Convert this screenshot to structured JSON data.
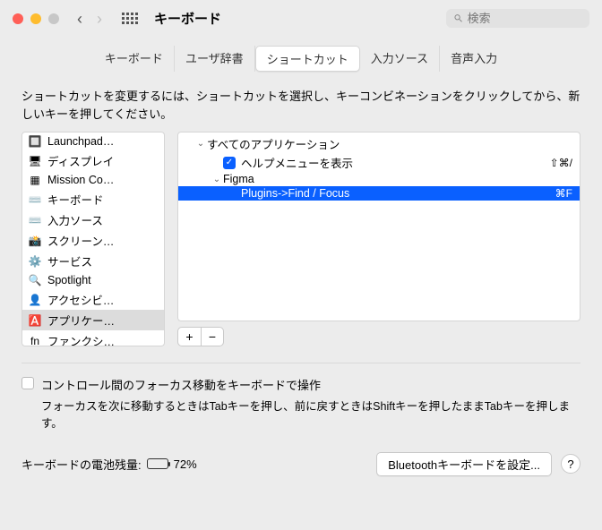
{
  "header": {
    "title": "キーボード",
    "search_placeholder": "検索"
  },
  "tabs": [
    {
      "label": "キーボード",
      "active": false
    },
    {
      "label": "ユーザ辞書",
      "active": false
    },
    {
      "label": "ショートカット",
      "active": true
    },
    {
      "label": "入力ソース",
      "active": false
    },
    {
      "label": "音声入力",
      "active": false
    }
  ],
  "panel": {
    "instruction": "ショートカットを変更するには、ショートカットを選択し、キーコンビネーションをクリックしてから、新しいキーを押してください。"
  },
  "categories": [
    {
      "icon": "🔲",
      "label": "Launchpad…",
      "selected": false
    },
    {
      "icon": "🖥",
      "label": "ディスプレイ",
      "selected": false
    },
    {
      "icon": "▦",
      "label": "Mission Co…",
      "selected": false
    },
    {
      "icon": "⌨️",
      "label": "キーボード",
      "selected": false
    },
    {
      "icon": "⌨️",
      "label": "入力ソース",
      "selected": false
    },
    {
      "icon": "📸",
      "label": "スクリーン…",
      "selected": false
    },
    {
      "icon": "⚙️",
      "label": "サービス",
      "selected": false
    },
    {
      "icon": "🔍",
      "label": "Spotlight",
      "selected": false
    },
    {
      "icon": "👤",
      "label": "アクセシビ…",
      "selected": false
    },
    {
      "icon": "🅰️",
      "label": "アプリケー…",
      "selected": true
    },
    {
      "icon": "fn",
      "label": "ファンクシ…",
      "selected": false
    }
  ],
  "shortcuts": {
    "root": {
      "label": "すべてのアプリケーション",
      "expanded": true
    },
    "rootChildren": [
      {
        "label": "ヘルプメニューを表示",
        "checked": true,
        "key": "⇧⌘/"
      }
    ],
    "apps": [
      {
        "name": "Figma",
        "expanded": true,
        "items": [
          {
            "label": "Plugins->Find / Focus",
            "key": "⌘F",
            "selected": true
          }
        ]
      }
    ]
  },
  "buttons": {
    "add": "+",
    "remove": "−"
  },
  "focus": {
    "label": "コントロール間のフォーカス移動をキーボードで操作",
    "sub": "フォーカスを次に移動するときはTabキーを押し、前に戻すときはShiftキーを押したままTabキーを押します。"
  },
  "footer": {
    "battery_label": "キーボードの電池残量:",
    "battery_pct": "72%",
    "battery_fill_pct": 72,
    "bluetooth_button": "Bluetoothキーボードを設定...",
    "help": "?"
  }
}
